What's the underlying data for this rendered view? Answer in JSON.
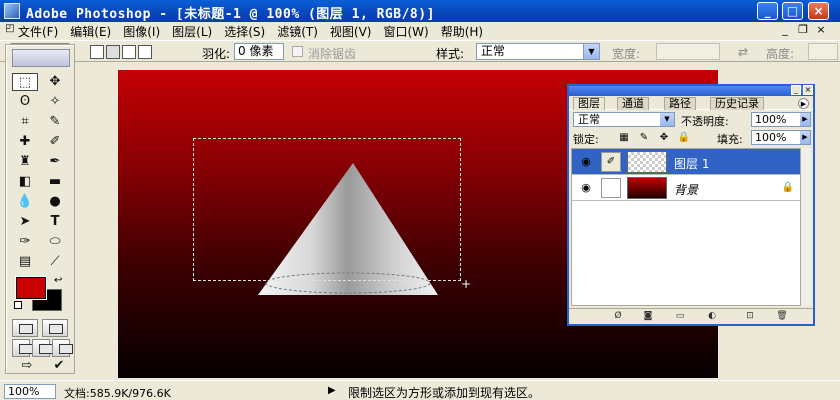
{
  "window": {
    "title": "Adobe Photoshop - [未标题-1 @ 100% (图层 1, RGB/8)]",
    "buttons": {
      "minimize": "_",
      "maximize": "□",
      "close": "×"
    }
  },
  "menubar": {
    "items": [
      "文件(F)",
      "编辑(E)",
      "图像(I)",
      "图层(L)",
      "选择(S)",
      "滤镜(T)",
      "视图(V)",
      "窗口(W)",
      "帮助(H)"
    ],
    "doc_controls": {
      "minimize": "_",
      "restore": "❐",
      "close": "×"
    }
  },
  "options": {
    "feather_label": "羽化:",
    "feather_value": "0 像素",
    "antialias_label": "消除锯齿",
    "style_label": "样式:",
    "style_value": "正常",
    "width_label": "宽度:",
    "height_label": "高度:"
  },
  "toolbox": {
    "foreground_color": "#c80000",
    "background_color": "#000000"
  },
  "layers_panel": {
    "tabs": [
      "图层",
      "通道",
      "路径",
      "历史记录"
    ],
    "blend_mode": "正常",
    "opacity_label": "不透明度:",
    "opacity_value": "100%",
    "lock_label": "锁定:",
    "fill_label": "填充:",
    "fill_value": "100%",
    "layers": [
      {
        "name": "图层 1",
        "selected": true
      },
      {
        "name": "背景",
        "selected": false
      }
    ]
  },
  "status": {
    "zoom": "100%",
    "doc_size": "文档:585.9K/976.6K",
    "hint": "限制选区为方形或添加到现有选区。"
  }
}
